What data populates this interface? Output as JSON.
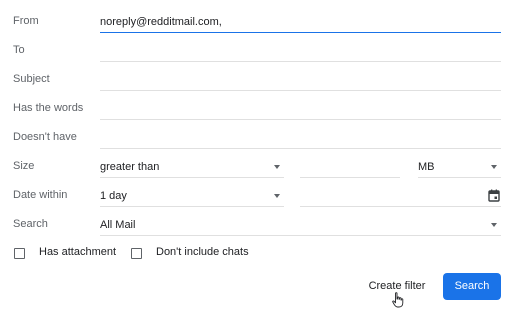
{
  "form": {
    "from": {
      "label": "From",
      "value": "noreply@redditmail.com,"
    },
    "to": {
      "label": "To",
      "value": ""
    },
    "subject": {
      "label": "Subject",
      "value": ""
    },
    "has_words": {
      "label": "Has the words",
      "value": ""
    },
    "doesnt_have": {
      "label": "Doesn't have",
      "value": ""
    },
    "size": {
      "label": "Size",
      "comparator": "greater than",
      "amount": "",
      "unit": "MB"
    },
    "date_within": {
      "label": "Date within",
      "range": "1 day",
      "date": ""
    },
    "search": {
      "label": "Search",
      "value": "All Mail"
    },
    "has_attachment": {
      "label": "Has attachment",
      "checked": false
    },
    "dont_include_chats": {
      "label": "Don't include chats",
      "checked": false
    }
  },
  "actions": {
    "create_filter": "Create filter",
    "search": "Search"
  },
  "icons": {
    "dropdown": "chevron-down-icon",
    "calendar": "calendar-icon",
    "cursor": "hand-pointer-icon"
  },
  "colors": {
    "accent": "#1a73e8",
    "label": "#5f6368",
    "divider": "#e0e0e0"
  }
}
